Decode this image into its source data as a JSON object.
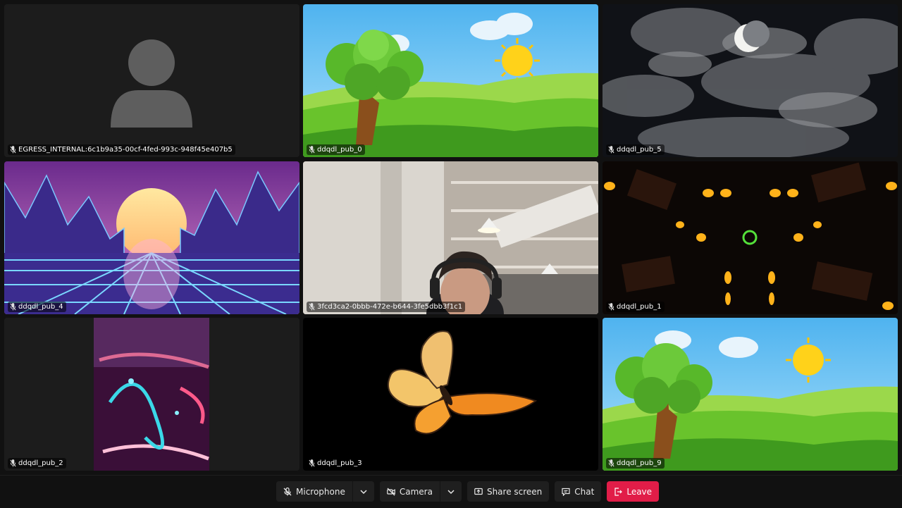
{
  "participants": [
    {
      "name": "EGRESS_INTERNAL:6c1b9a35-00cf-4fed-993c-948f45e407b5"
    },
    {
      "name": "ddqdl_pub_0"
    },
    {
      "name": "ddqdl_pub_5"
    },
    {
      "name": "ddqdl_pub_4"
    },
    {
      "name": "3fcd3ca2-0bbb-472e-b644-3fe5dbb3f1c1"
    },
    {
      "name": "ddqdl_pub_1"
    },
    {
      "name": "ddqdl_pub_2"
    },
    {
      "name": "ddqdl_pub_3"
    },
    {
      "name": "ddqdl_pub_9"
    }
  ],
  "controls": {
    "microphone": "Microphone",
    "camera": "Camera",
    "share_screen": "Share screen",
    "chat": "Chat",
    "leave": "Leave"
  },
  "colors": {
    "leave": "#e11d48",
    "tile_bg": "#1c1c1c",
    "control_bg": "#1f1f1f"
  }
}
